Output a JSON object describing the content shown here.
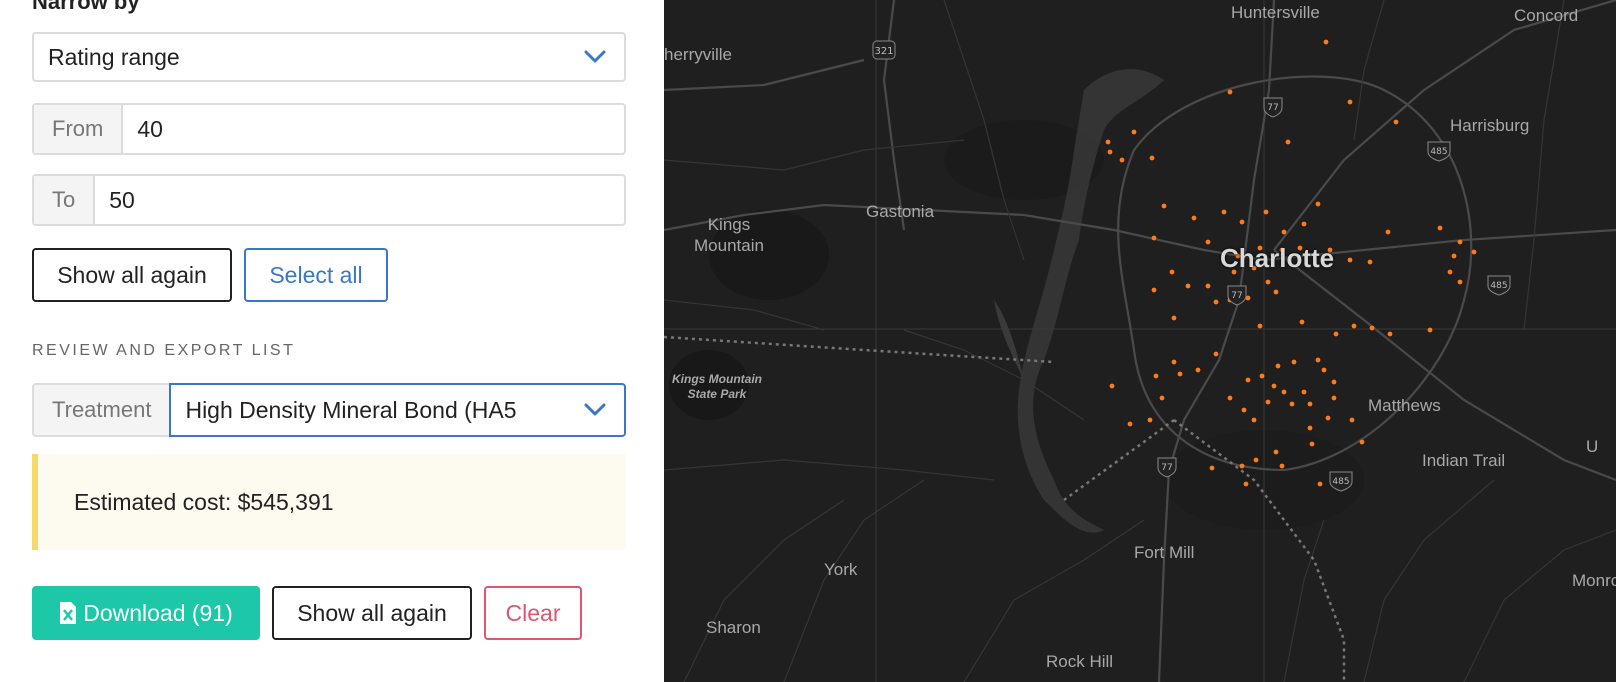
{
  "filter": {
    "title": "Narrow by",
    "select_value": "Rating range",
    "from_label": "From",
    "from_value": "40",
    "to_label": "To",
    "to_value": "50",
    "show_all_label": "Show all again",
    "select_all_label": "Select all"
  },
  "review": {
    "section_label": "REVIEW AND EXPORT LIST",
    "treatment_label": "Treatment",
    "treatment_value": "High Density Mineral Bond (HA5",
    "estimated_cost": "Estimated cost: $545,391",
    "download_label": "Download (91)",
    "show_all_label": "Show all again",
    "clear_label": "Clear"
  },
  "colors": {
    "accent_blue": "#3a77c9",
    "download_teal": "#1dc8a8",
    "clear_red": "#e0556f",
    "alert_border": "#f5d96b",
    "map_background": "#1f1f1f",
    "point_orange": "#ff7a1a"
  },
  "map": {
    "places": {
      "huntersville": "Huntersville",
      "concord": "Concord",
      "cherryville": "herryville",
      "harrisburg": "Harrisburg",
      "kings_mountain": "Kings\nMountain",
      "gastonia": "Gastonia",
      "charlotte": "Charlotte",
      "kings_mountain_park": "Kings Mountain\nState Park",
      "matthews": "Matthews",
      "indian_trail": "Indian Trail",
      "york": "York",
      "fort_mill": "Fort Mill",
      "sharon": "Sharon",
      "rock_hill": "Rock Hill",
      "monroe": "Monro",
      "edge_u": "U"
    },
    "shields": [
      "321",
      "77",
      "485",
      "77",
      "485",
      "77",
      "485",
      "485"
    ]
  }
}
